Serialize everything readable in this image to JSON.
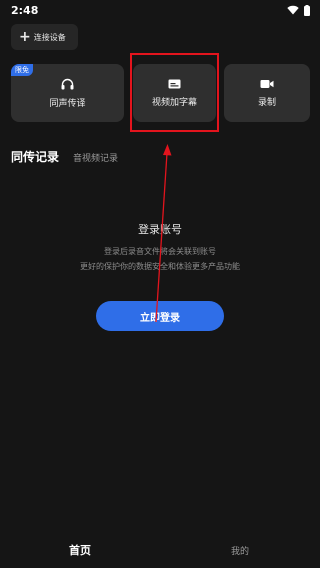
{
  "status": {
    "time": "2:48"
  },
  "connect": {
    "label": "连接设备"
  },
  "cards": [
    {
      "label": "同声传译",
      "badge": "限免",
      "icon": "headphones-icon"
    },
    {
      "label": "视频加字幕",
      "icon": "subtitle-icon"
    },
    {
      "label": "录制",
      "icon": "video-camera-icon"
    }
  ],
  "tabs": {
    "active": "同传记录",
    "inactive": "音视频记录"
  },
  "empty": {
    "title": "登录账号",
    "line1": "登录后录音文件将会关联到账号",
    "line2": "更好的保护你的数据安全和体验更多产品功能"
  },
  "login": {
    "label": "立即登录"
  },
  "nav": {
    "home": "首页",
    "mine": "我的"
  },
  "colors": {
    "accent": "#2f6ee8",
    "annotation": "#e3141d",
    "background": "#151515",
    "card": "#2f2f2f"
  }
}
